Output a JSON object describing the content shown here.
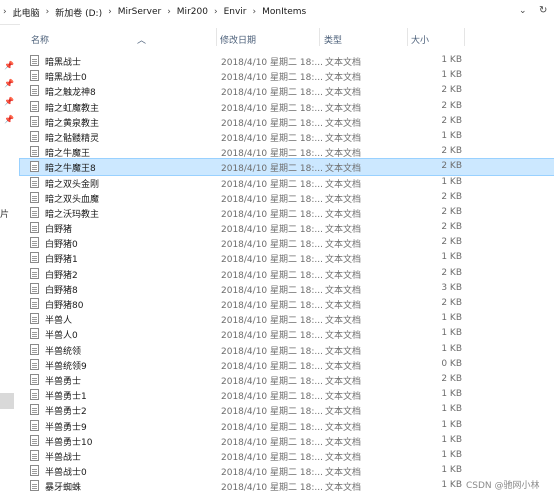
{
  "address_bar": {
    "breadcrumbs": [
      "此电脑",
      "新加卷 (D:)",
      "MirServer",
      "Mir200",
      "Envir",
      "MonItems"
    ]
  },
  "nav_pane": {
    "partial_label": "片"
  },
  "columns": {
    "name": "名称",
    "date": "修改日期",
    "type": "类型",
    "size": "大小"
  },
  "files": [
    {
      "name": "暗黑战士",
      "date": "2018/4/10 星期二 18:...",
      "type": "文本文档",
      "size": "1 KB"
    },
    {
      "name": "暗黑战士0",
      "date": "2018/4/10 星期二 18:...",
      "type": "文本文档",
      "size": "1 KB"
    },
    {
      "name": "暗之触龙神8",
      "date": "2018/4/10 星期二 18:...",
      "type": "文本文档",
      "size": "2 KB"
    },
    {
      "name": "暗之虹魔教主",
      "date": "2018/4/10 星期二 18:...",
      "type": "文本文档",
      "size": "2 KB"
    },
    {
      "name": "暗之黄泉教主",
      "date": "2018/4/10 星期二 18:...",
      "type": "文本文档",
      "size": "2 KB"
    },
    {
      "name": "暗之骷髅精灵",
      "date": "2018/4/10 星期二 18:...",
      "type": "文本文档",
      "size": "1 KB"
    },
    {
      "name": "暗之牛魔王",
      "date": "2018/4/10 星期二 18:...",
      "type": "文本文档",
      "size": "2 KB"
    },
    {
      "name": "暗之牛魔王8",
      "date": "2018/4/10 星期二 18:...",
      "type": "文本文档",
      "size": "2 KB"
    },
    {
      "name": "暗之双头金刚",
      "date": "2018/4/10 星期二 18:...",
      "type": "文本文档",
      "size": "1 KB"
    },
    {
      "name": "暗之双头血魔",
      "date": "2018/4/10 星期二 18:...",
      "type": "文本文档",
      "size": "2 KB"
    },
    {
      "name": "暗之沃玛教主",
      "date": "2018/4/10 星期二 18:...",
      "type": "文本文档",
      "size": "2 KB"
    },
    {
      "name": "白野猪",
      "date": "2018/4/10 星期二 18:...",
      "type": "文本文档",
      "size": "2 KB"
    },
    {
      "name": "白野猪0",
      "date": "2018/4/10 星期二 18:...",
      "type": "文本文档",
      "size": "2 KB"
    },
    {
      "name": "白野猪1",
      "date": "2018/4/10 星期二 18:...",
      "type": "文本文档",
      "size": "1 KB"
    },
    {
      "name": "白野猪2",
      "date": "2018/4/10 星期二 18:...",
      "type": "文本文档",
      "size": "2 KB"
    },
    {
      "name": "白野猪8",
      "date": "2018/4/10 星期二 18:...",
      "type": "文本文档",
      "size": "3 KB"
    },
    {
      "name": "白野猪80",
      "date": "2018/4/10 星期二 18:...",
      "type": "文本文档",
      "size": "2 KB"
    },
    {
      "name": "半兽人",
      "date": "2018/4/10 星期二 18:...",
      "type": "文本文档",
      "size": "1 KB"
    },
    {
      "name": "半兽人0",
      "date": "2018/4/10 星期二 18:...",
      "type": "文本文档",
      "size": "1 KB"
    },
    {
      "name": "半兽统领",
      "date": "2018/4/10 星期二 18:...",
      "type": "文本文档",
      "size": "1 KB"
    },
    {
      "name": "半兽统领9",
      "date": "2018/4/10 星期二 18:...",
      "type": "文本文档",
      "size": "0 KB"
    },
    {
      "name": "半兽勇士",
      "date": "2018/4/10 星期二 18:...",
      "type": "文本文档",
      "size": "2 KB"
    },
    {
      "name": "半兽勇士1",
      "date": "2018/4/10 星期二 18:...",
      "type": "文本文档",
      "size": "1 KB"
    },
    {
      "name": "半兽勇士2",
      "date": "2018/4/10 星期二 18:...",
      "type": "文本文档",
      "size": "1 KB"
    },
    {
      "name": "半兽勇士9",
      "date": "2018/4/10 星期二 18:...",
      "type": "文本文档",
      "size": "1 KB"
    },
    {
      "name": "半兽勇士10",
      "date": "2018/4/10 星期二 18:...",
      "type": "文本文档",
      "size": "1 KB"
    },
    {
      "name": "半兽战士",
      "date": "2018/4/10 星期二 18:...",
      "type": "文本文档",
      "size": "1 KB"
    },
    {
      "name": "半兽战士0",
      "date": "2018/4/10 星期二 18:...",
      "type": "文本文档",
      "size": "1 KB"
    },
    {
      "name": "暴牙蜘蛛",
      "date": "2018/4/10 星期二 18:...",
      "type": "文本文档",
      "size": "1 KB"
    }
  ],
  "selected_index": 7,
  "watermark": "CSDN @驰网小林",
  "colors": {
    "selection": "#cce8ff",
    "selection_border": "#99d1ff",
    "header_text": "#4c607a",
    "pin": "#4a6f9a"
  }
}
